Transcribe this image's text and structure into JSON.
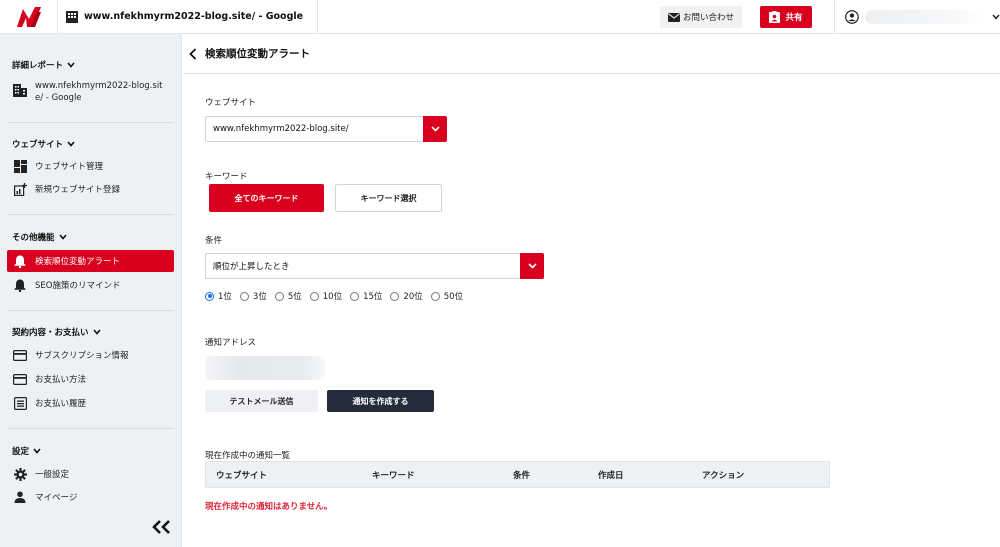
{
  "topbar": {
    "site_title": "www.nfekhmyrm2022-blog.site/ - Google",
    "contact_label": "お問い合わせ",
    "share_label": "共有",
    "user_name": ""
  },
  "sidebar": {
    "sections": [
      {
        "title": "詳細レポート"
      },
      {
        "title": "ウェブサイト"
      },
      {
        "title": "その他機能"
      },
      {
        "title": "契約内容・お支払い"
      },
      {
        "title": "設定"
      }
    ],
    "report_site": "www.nfekhmyrm2022-blog.site/ - Google",
    "items": [
      {
        "label": "ウェブサイト管理",
        "icon": "dashboard-icon"
      },
      {
        "label": "新規ウェブサイト登録",
        "icon": "add-site-icon"
      },
      {
        "label": "検索順位変動アラート",
        "icon": "bell-icon"
      },
      {
        "label": "SEO施策のリマインド",
        "icon": "bell-icon"
      },
      {
        "label": "サブスクリプション情報",
        "icon": "card-icon"
      },
      {
        "label": "お支払い方法",
        "icon": "card-icon"
      },
      {
        "label": "お支払い履歴",
        "icon": "list-icon"
      },
      {
        "label": "一般設定",
        "icon": "gear-icon"
      },
      {
        "label": "マイページ",
        "icon": "person-icon"
      }
    ]
  },
  "main": {
    "page_title": "検索順位変動アラート",
    "website_label": "ウェブサイト",
    "website_value": "www.nfekhmyrm2022-blog.site/",
    "keyword_label": "キーワード",
    "kw_all": "全てのキーワード",
    "kw_select": "キーワード選択",
    "condition_label": "条件",
    "condition_value": "順位が上昇したとき",
    "ranks": [
      "1位",
      "3位",
      "5位",
      "10位",
      "15位",
      "20位",
      "50位"
    ],
    "selected_rank": "1位",
    "address_label": "通知アドレス",
    "test_mail": "テストメール送信",
    "create_notice": "通知を作成する",
    "list_title": "現在作成中の通知一覧",
    "columns": [
      "ウェブサイト",
      "キーワード",
      "条件",
      "作成日",
      "アクション"
    ],
    "empty_message": "現在作成中の通知はありません。"
  },
  "colors": {
    "accent": "#d8001e",
    "dark_button": "#252b3a",
    "sidebar_bg": "#eef1f4"
  }
}
